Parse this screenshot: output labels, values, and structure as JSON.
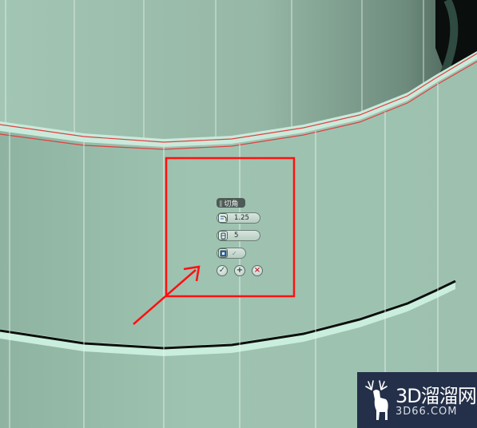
{
  "viewport": {
    "background_color": "#9fc2b0",
    "annotation_color": "#ff1010"
  },
  "caddy": {
    "title": "切角",
    "title_grip_icon": "grip-icon",
    "amount": {
      "icon": "chamfer-amount-icon",
      "value": "1.25"
    },
    "segments": {
      "icon": "chamfer-segments-icon",
      "value": "5"
    },
    "mode": {
      "icon": "open-chamfer-icon",
      "toggle_icon": "check-icon"
    },
    "buttons": {
      "ok_icon": "check-icon",
      "apply_icon": "plus-icon",
      "cancel_icon": "close-icon"
    }
  },
  "watermark": {
    "brand": "3D溜溜网",
    "url": "3D66.COM",
    "logo_icon": "deer-icon"
  }
}
